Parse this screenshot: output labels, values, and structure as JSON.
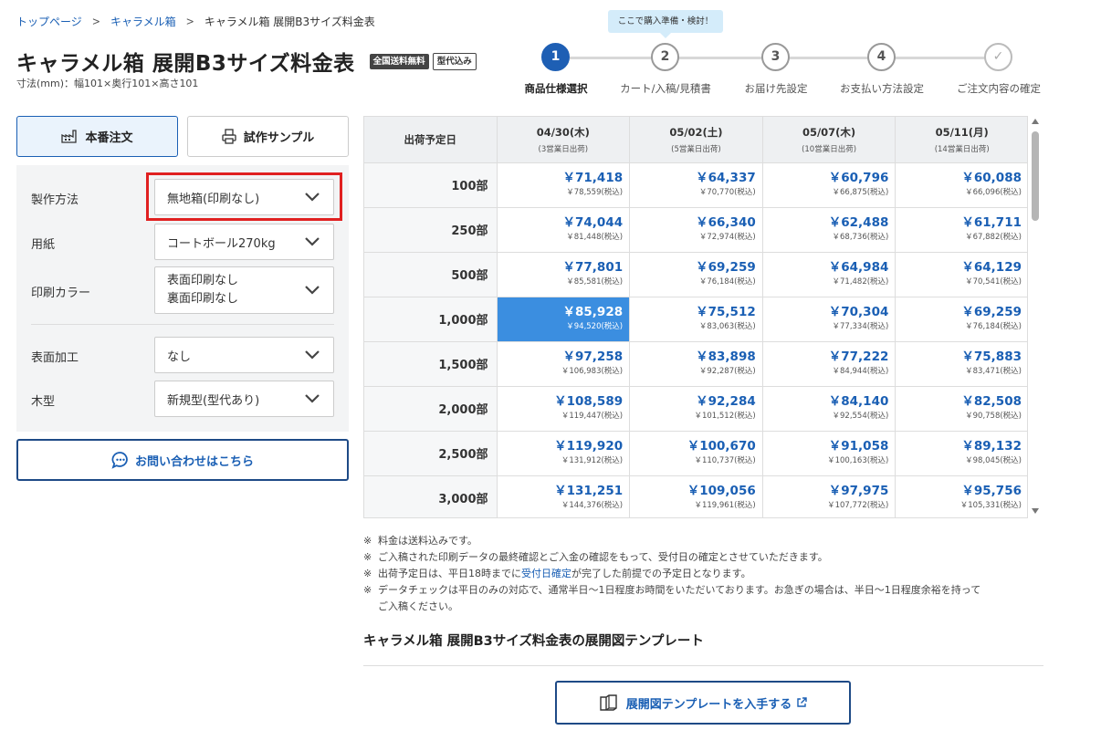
{
  "breadcrumb": {
    "items": [
      "トップページ",
      "キャラメル箱",
      "キャラメル箱 展開B3サイズ料金表"
    ],
    "separator": ">"
  },
  "header": {
    "title": "キャラメル箱 展開B3サイズ料金表",
    "badges": [
      "全国送料無料",
      "型代込み"
    ],
    "dimensions": "寸法(mm)：幅101×奥行101×高さ101"
  },
  "stepper": {
    "tooltip": "ここで購入準備・検討！",
    "steps": [
      {
        "number": "1",
        "label": "商品仕様選択",
        "active": true
      },
      {
        "number": "2",
        "label": "カート/入稿/見積書",
        "active": false
      },
      {
        "number": "3",
        "label": "お届け先設定",
        "active": false
      },
      {
        "number": "4",
        "label": "お支払い方法設定",
        "active": false
      },
      {
        "number": "✓",
        "label": "ご注文内容の確定",
        "active": false
      }
    ]
  },
  "tabs": [
    {
      "label": "本番注文",
      "icon": "factory-icon",
      "active": true
    },
    {
      "label": "試作サンプル",
      "icon": "printer-icon",
      "active": false
    }
  ],
  "options": [
    {
      "label": "製作方法",
      "value": "無地箱(印刷なし)"
    },
    {
      "label": "用紙",
      "value": "コートボール270kg"
    },
    {
      "label": "印刷カラー",
      "value_line1": "表面印刷なし",
      "value_line2": "裏面印刷なし"
    },
    {
      "label": "表面加工",
      "value": "なし"
    },
    {
      "label": "木型",
      "value": "新規型(型代あり)"
    }
  ],
  "contact": {
    "label": "お問い合わせはこちら",
    "icon": "chat-icon"
  },
  "price_table": {
    "corner_header": "出荷予定日",
    "columns": [
      {
        "date": "04/30(木)",
        "note": "(3営業日出荷)"
      },
      {
        "date": "05/02(土)",
        "note": "(5営業日出荷)"
      },
      {
        "date": "05/07(木)",
        "note": "(10営業日出荷)"
      },
      {
        "date": "05/11(月)",
        "note": "(14営業日出荷)"
      }
    ],
    "selected": {
      "row": 3,
      "col": 0
    },
    "rows": [
      {
        "qty": "100部",
        "cells": [
          {
            "price": "￥71,418",
            "tax": "￥78,559(税込)"
          },
          {
            "price": "￥64,337",
            "tax": "￥70,770(税込)"
          },
          {
            "price": "￥60,796",
            "tax": "￥66,875(税込)"
          },
          {
            "price": "￥60,088",
            "tax": "￥66,096(税込)"
          }
        ]
      },
      {
        "qty": "250部",
        "cells": [
          {
            "price": "￥74,044",
            "tax": "￥81,448(税込)"
          },
          {
            "price": "￥66,340",
            "tax": "￥72,974(税込)"
          },
          {
            "price": "￥62,488",
            "tax": "￥68,736(税込)"
          },
          {
            "price": "￥61,711",
            "tax": "￥67,882(税込)"
          }
        ]
      },
      {
        "qty": "500部",
        "cells": [
          {
            "price": "￥77,801",
            "tax": "￥85,581(税込)"
          },
          {
            "price": "￥69,259",
            "tax": "￥76,184(税込)"
          },
          {
            "price": "￥64,984",
            "tax": "￥71,482(税込)"
          },
          {
            "price": "￥64,129",
            "tax": "￥70,541(税込)"
          }
        ]
      },
      {
        "qty": "1,000部",
        "cells": [
          {
            "price": "￥85,928",
            "tax": "￥94,520(税込)"
          },
          {
            "price": "￥75,512",
            "tax": "￥83,063(税込)"
          },
          {
            "price": "￥70,304",
            "tax": "￥77,334(税込)"
          },
          {
            "price": "￥69,259",
            "tax": "￥76,184(税込)"
          }
        ]
      },
      {
        "qty": "1,500部",
        "cells": [
          {
            "price": "￥97,258",
            "tax": "￥106,983(税込)"
          },
          {
            "price": "￥83,898",
            "tax": "￥92,287(税込)"
          },
          {
            "price": "￥77,222",
            "tax": "￥84,944(税込)"
          },
          {
            "price": "￥75,883",
            "tax": "￥83,471(税込)"
          }
        ]
      },
      {
        "qty": "2,000部",
        "cells": [
          {
            "price": "￥108,589",
            "tax": "￥119,447(税込)"
          },
          {
            "price": "￥92,284",
            "tax": "￥101,512(税込)"
          },
          {
            "price": "￥84,140",
            "tax": "￥92,554(税込)"
          },
          {
            "price": "￥82,508",
            "tax": "￥90,758(税込)"
          }
        ]
      },
      {
        "qty": "2,500部",
        "cells": [
          {
            "price": "￥119,920",
            "tax": "￥131,912(税込)"
          },
          {
            "price": "￥100,670",
            "tax": "￥110,737(税込)"
          },
          {
            "price": "￥91,058",
            "tax": "￥100,163(税込)"
          },
          {
            "price": "￥89,132",
            "tax": "￥98,045(税込)"
          }
        ]
      },
      {
        "qty": "3,000部",
        "cells": [
          {
            "price": "￥131,251",
            "tax": "￥144,376(税込)"
          },
          {
            "price": "￥109,056",
            "tax": "￥119,961(税込)"
          },
          {
            "price": "￥97,975",
            "tax": "￥107,772(税込)"
          },
          {
            "price": "￥95,756",
            "tax": "￥105,331(税込)"
          }
        ]
      }
    ]
  },
  "notes": {
    "marker": "※",
    "n1": "料金は送料込みです。",
    "n2": "ご入稿された印刷データの最終確認とご入金の確認をもって、受付日の確定とさせていただきます。",
    "n3_before": "出荷予定日は、平日18時までに",
    "n3_link": "受付日確定",
    "n3_after": "が完了した前提での予定日となります。",
    "n4_line1": "データチェックは平日のみの対応で、通常半日〜1日程度お時間をいただいております。お急ぎの場合は、半日〜1日程度余裕を持って",
    "n4_line2": "ご入稿ください。"
  },
  "template_section": {
    "title": "キャラメル箱 展開B3サイズ料金表の展開図テンプレート",
    "button_label": "展開図テンプレートを入手する"
  },
  "colors": {
    "accent": "#1a5fb4",
    "selected_cell": "#3b8ee0",
    "highlight_border": "#e02020",
    "tooltip_bg": "#d4ecfa"
  }
}
